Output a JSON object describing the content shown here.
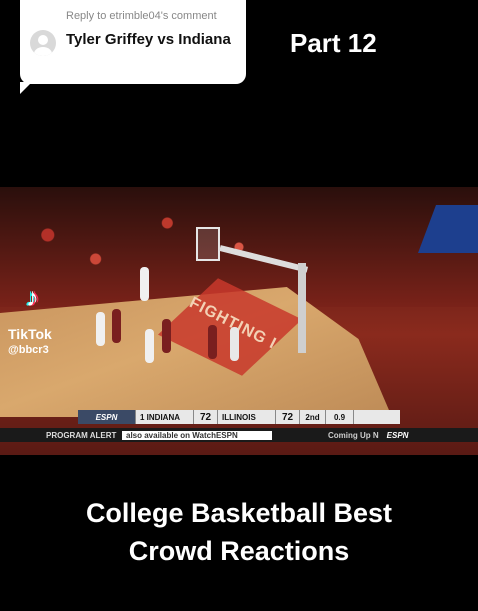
{
  "reply": {
    "header": "Reply to etrimble04's comment",
    "text": "Tyler Griffey vs Indiana"
  },
  "part_label": "Part 12",
  "video": {
    "court_text": "FIGHTING I",
    "watermark": {
      "name": "TikTok",
      "handle": "@bbcr3"
    },
    "scoreboard": {
      "network": "ESPN",
      "away_team": "1 INDIANA",
      "away_score": "72",
      "home_team": "ILLINOIS",
      "home_score": "72",
      "period": "2nd",
      "clock": "0.9"
    },
    "ticker": {
      "label": "PROGRAM ALERT",
      "message": "also available on WatchESPN",
      "next": "Coming Up N",
      "logo": "ESPN"
    }
  },
  "caption": {
    "line1": "College Basketball Best",
    "line2": "Crowd Reactions"
  },
  "colors": {
    "background": "#000000",
    "bubble": "#ffffff"
  }
}
